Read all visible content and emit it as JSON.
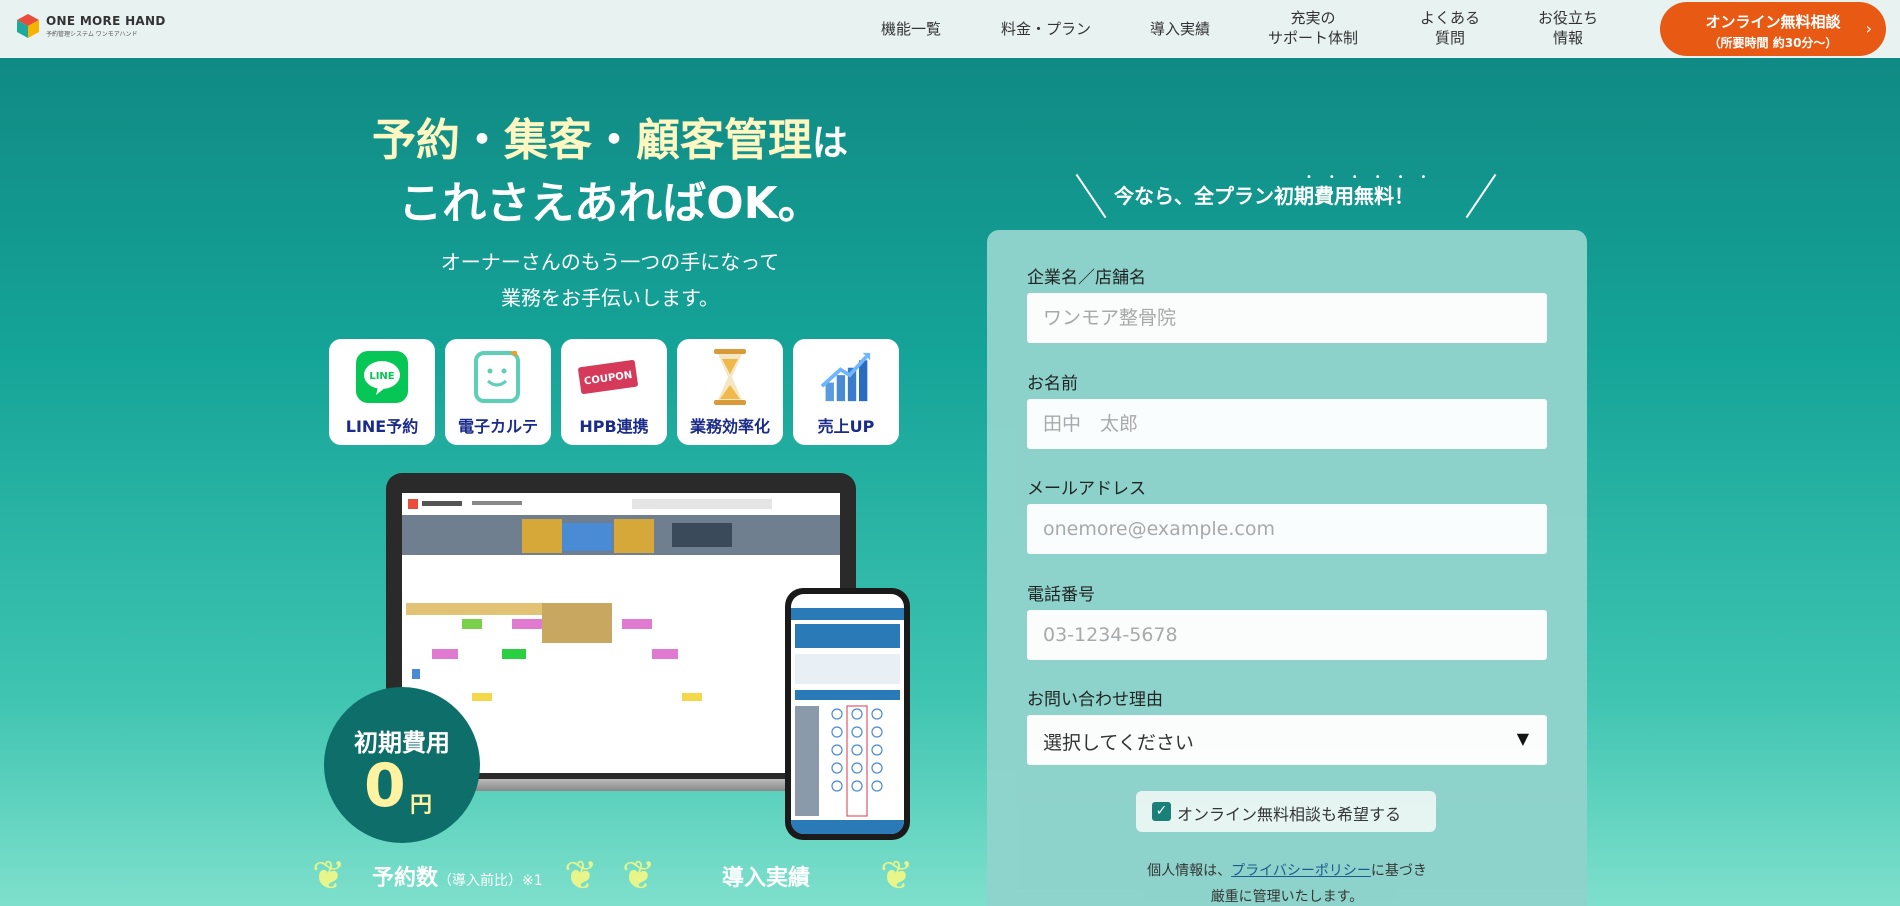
{
  "header": {
    "logo_title": "ONE MORE HAND",
    "logo_sub": "予約管理システム ワンモアハンド",
    "nav": [
      {
        "label": "機能一覧"
      },
      {
        "label": "料金・プラン"
      },
      {
        "label": "導入実績"
      },
      {
        "label": "充実の\nサポート体制"
      },
      {
        "label": "よくある\n質問"
      },
      {
        "label": "お役立ち\n情報"
      }
    ],
    "cta_main": "オンライン無料相談",
    "cta_sub": "（所要時間 約30分〜）"
  },
  "hero": {
    "headline_parts": [
      "予約",
      "・",
      "集客",
      "・",
      "顧客管理",
      "は"
    ],
    "headline_line2": "これさえあればOK。",
    "subcopy_1": "オーナーさんのもう一つの手になって",
    "subcopy_2": "業務をお手伝いします。",
    "features": [
      {
        "label": "LINE予約",
        "icon": "line-icon"
      },
      {
        "label": "電子カルテ",
        "icon": "tablet-icon"
      },
      {
        "label": "HPB連携",
        "icon": "coupon-icon"
      },
      {
        "label": "業務効率化",
        "icon": "hourglass-icon"
      },
      {
        "label": "売上UP",
        "icon": "growth-chart-icon"
      }
    ],
    "coupon_text": "COUPON",
    "badge_label": "初期費用",
    "badge_value": "0",
    "badge_unit": "円",
    "stat_a_label": "予約数",
    "stat_a_note": "（導入前比）※1",
    "stat_b_label": "導入実績"
  },
  "form": {
    "offer_text": "今なら、全プラン初期費用無料！",
    "fields": [
      {
        "label": "企業名／店舗名",
        "placeholder": "ワンモア整骨院"
      },
      {
        "label": "お名前",
        "placeholder": "田中　太郎"
      },
      {
        "label": "メールアドレス",
        "placeholder": "onemore@example.com"
      },
      {
        "label": "電話番号",
        "placeholder": "03-1234-5678"
      }
    ],
    "reason_label": "お問い合わせ理由",
    "reason_selected": "選択してください",
    "consult_label": "オンライン無料相談も希望する",
    "privacy_pre": "個人情報は、",
    "privacy_link": "プライバシーポリシー",
    "privacy_post": "に基づき",
    "privacy_line2": "厳重に管理いたします。"
  },
  "colors": {
    "brand_teal": "#14a39a",
    "cta_orange": "#e85a14",
    "feature_text": "#1a2b8a",
    "highlight_yellow": "#fff7c2"
  }
}
